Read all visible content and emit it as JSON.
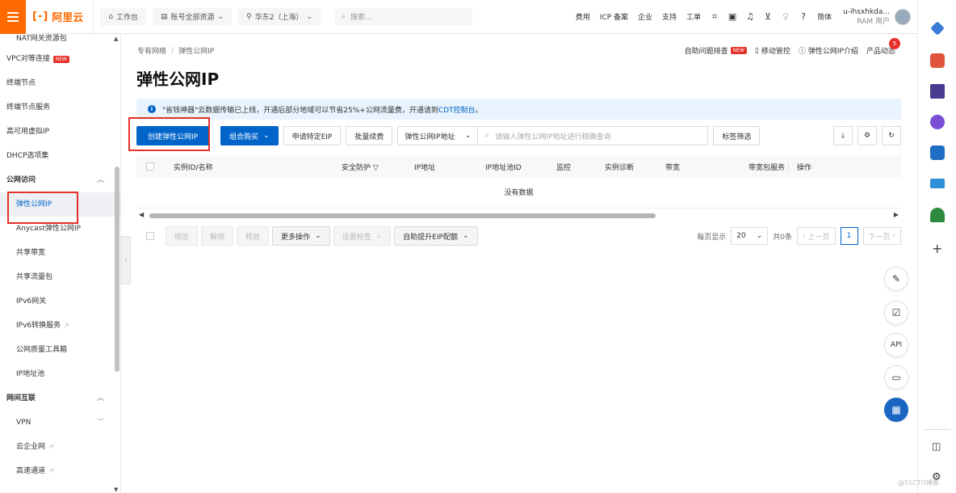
{
  "topbar": {
    "logo_text": "阿里云",
    "logo_bracket": "[-]",
    "workbench": "工作台",
    "account_scope": "账号全部资源",
    "region": "华东2（上海）",
    "search_placeholder": "搜索...",
    "links": [
      "费用",
      "ICP 备案",
      "企业",
      "支持",
      "工单"
    ],
    "language": "简体",
    "user_name": "u-ihsxhkda...",
    "user_role": "RAM 用户"
  },
  "sidebar": {
    "items": [
      {
        "label": "NAT网关资源包",
        "type": "sub-plain"
      },
      {
        "label": "VPC对等连接",
        "type": "plain",
        "badge": "NEW"
      },
      {
        "label": "终端节点",
        "type": "plain"
      },
      {
        "label": "终端节点服务",
        "type": "plain"
      },
      {
        "label": "高可用虚拟IP",
        "type": "plain"
      },
      {
        "label": "DHCP选项集",
        "type": "plain"
      },
      {
        "label": "公网访问",
        "type": "group"
      },
      {
        "label": "弹性公网IP",
        "type": "sub",
        "active": true
      },
      {
        "label": "Anycast弹性公网IP",
        "type": "sub"
      },
      {
        "label": "共享带宽",
        "type": "sub"
      },
      {
        "label": "共享流量包",
        "type": "sub"
      },
      {
        "label": "IPv6网关",
        "type": "sub"
      },
      {
        "label": "IPv6转换服务",
        "type": "sub",
        "external": true
      },
      {
        "label": "公网质量工具箱",
        "type": "sub"
      },
      {
        "label": "IP地址池",
        "type": "sub"
      },
      {
        "label": "网间互联",
        "type": "group"
      },
      {
        "label": "VPN",
        "type": "sub",
        "chevron": true
      },
      {
        "label": "云企业网",
        "type": "sub",
        "external": true
      },
      {
        "label": "高速通道",
        "type": "sub",
        "external": true
      }
    ]
  },
  "breadcrumb": {
    "parent": "专有网络",
    "current": "弹性公网IP"
  },
  "header_links": {
    "self_check": "自助问题排查",
    "self_check_badge": "NEW",
    "mobile": "移动管控",
    "intro": "弹性公网IP介绍",
    "news": "产品动态",
    "news_count": "5"
  },
  "page_title": "弹性公网IP",
  "notice": {
    "text": "\"省钱神器\"云数据传输已上线，开通后部分地域可以节省25%+公网流量费，开通请到",
    "link": "CDT控制台",
    "end": "。"
  },
  "toolbar": {
    "create": "创建弹性公网IP",
    "combo": "组合购买",
    "apply_special": "申请特定EIP",
    "batch_renew": "批量续费",
    "filter_select": "弹性公网IP地址",
    "search_placeholder": "请输入弹性公网IP地址进行精确查询",
    "tag_filter": "标签筛选"
  },
  "table": {
    "columns": [
      "实例ID/名称",
      "安全防护",
      "IP地址",
      "IP地址池ID",
      "监控",
      "实例诊断",
      "带宽",
      "带宽包服务",
      "操作"
    ],
    "empty_text": "没有数据"
  },
  "bottom": {
    "bind": "绑定",
    "unbind": "解绑",
    "release": "释放",
    "more": "更多操作",
    "set_tag": "设置标签",
    "quota": "自助提升EIP配额",
    "per_page_label": "每页显示",
    "per_page": "20",
    "total": "共0条",
    "prev": "上一页",
    "page": "1",
    "next": "下一页"
  },
  "floating": {
    "api": "API"
  },
  "watermark": "@51CTO博客",
  "colors": {
    "brand": "#ff6a00",
    "primary": "#0064c8",
    "highlight": "#e5312a"
  }
}
